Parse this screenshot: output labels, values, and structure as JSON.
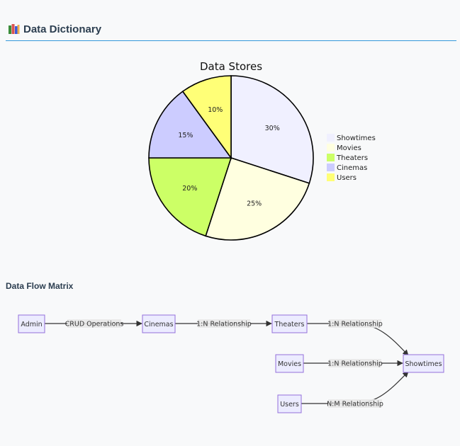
{
  "header": {
    "title": "Data Dictionary",
    "icon": "books-icon"
  },
  "chart_data": {
    "type": "pie",
    "title": "Data Stores",
    "slices": [
      {
        "label": "Showtimes",
        "value": 30,
        "display": "30%",
        "color": "#f0f0ff"
      },
      {
        "label": "Movies",
        "value": 25,
        "display": "25%",
        "color": "#ffffe0"
      },
      {
        "label": "Theaters",
        "value": 20,
        "display": "20%",
        "color": "#ccff66"
      },
      {
        "label": "Cinemas",
        "value": 15,
        "display": "15%",
        "color": "#ccccff"
      },
      {
        "label": "Users",
        "value": 10,
        "display": "10%",
        "color": "#ffff77"
      }
    ],
    "legend": "right"
  },
  "flow": {
    "title": "Data Flow Matrix",
    "nodes": {
      "admin": "Admin",
      "cinemas": "Cinemas",
      "theaters": "Theaters",
      "movies": "Movies",
      "users": "Users",
      "showtimes": "Showtimes"
    },
    "edges": {
      "admin_cinemas": "CRUD Operations",
      "cinemas_theaters": "1:N Relationship",
      "theaters_showtimes": "1:N Relationship",
      "movies_showtimes": "1:N Relationship",
      "users_showtimes": "N:M Relationship"
    }
  }
}
